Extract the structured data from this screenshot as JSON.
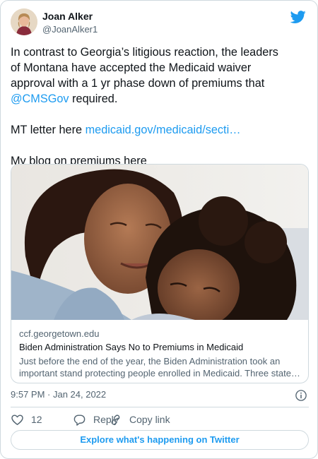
{
  "author": {
    "display_name": "Joan Alker",
    "handle": "@JoanAlker1"
  },
  "tweet": {
    "line1": "In contrast to Georgia’s litigious reaction, the leaders",
    "line2": "of Montana have accepted the Medicaid waiver",
    "line3": "approval with a 1 yr phase down of premiums that",
    "mention": "@CMSGov",
    "line4_rest": " required.",
    "mt_prefix": "MT letter here ",
    "mt_link": "medicaid.gov/medicaid/secti…",
    "blog": "My blog on premiums here"
  },
  "link_card": {
    "domain": "ccf.georgetown.edu",
    "title": "Biden Administration Says No to Premiums in Medicaid",
    "desc_line1": "Just before the end of the year, the Biden Administration took an",
    "desc_line2": "important stand protecting people enrolled in Medicaid. Three state…"
  },
  "timestamp": "9:57 PM · Jan 24, 2022",
  "actions": {
    "like_count": "12",
    "reply_label": "Reply",
    "copy_label": "Copy link"
  },
  "explore_label": "Explore what's happening on Twitter",
  "colors": {
    "accent": "#1d9bf0",
    "secondary_text": "#536471",
    "border": "#cfd9de"
  },
  "icons": [
    "avatar-photo",
    "twitter-bird-icon",
    "info-icon",
    "heart-icon",
    "reply-icon",
    "link-icon"
  ]
}
